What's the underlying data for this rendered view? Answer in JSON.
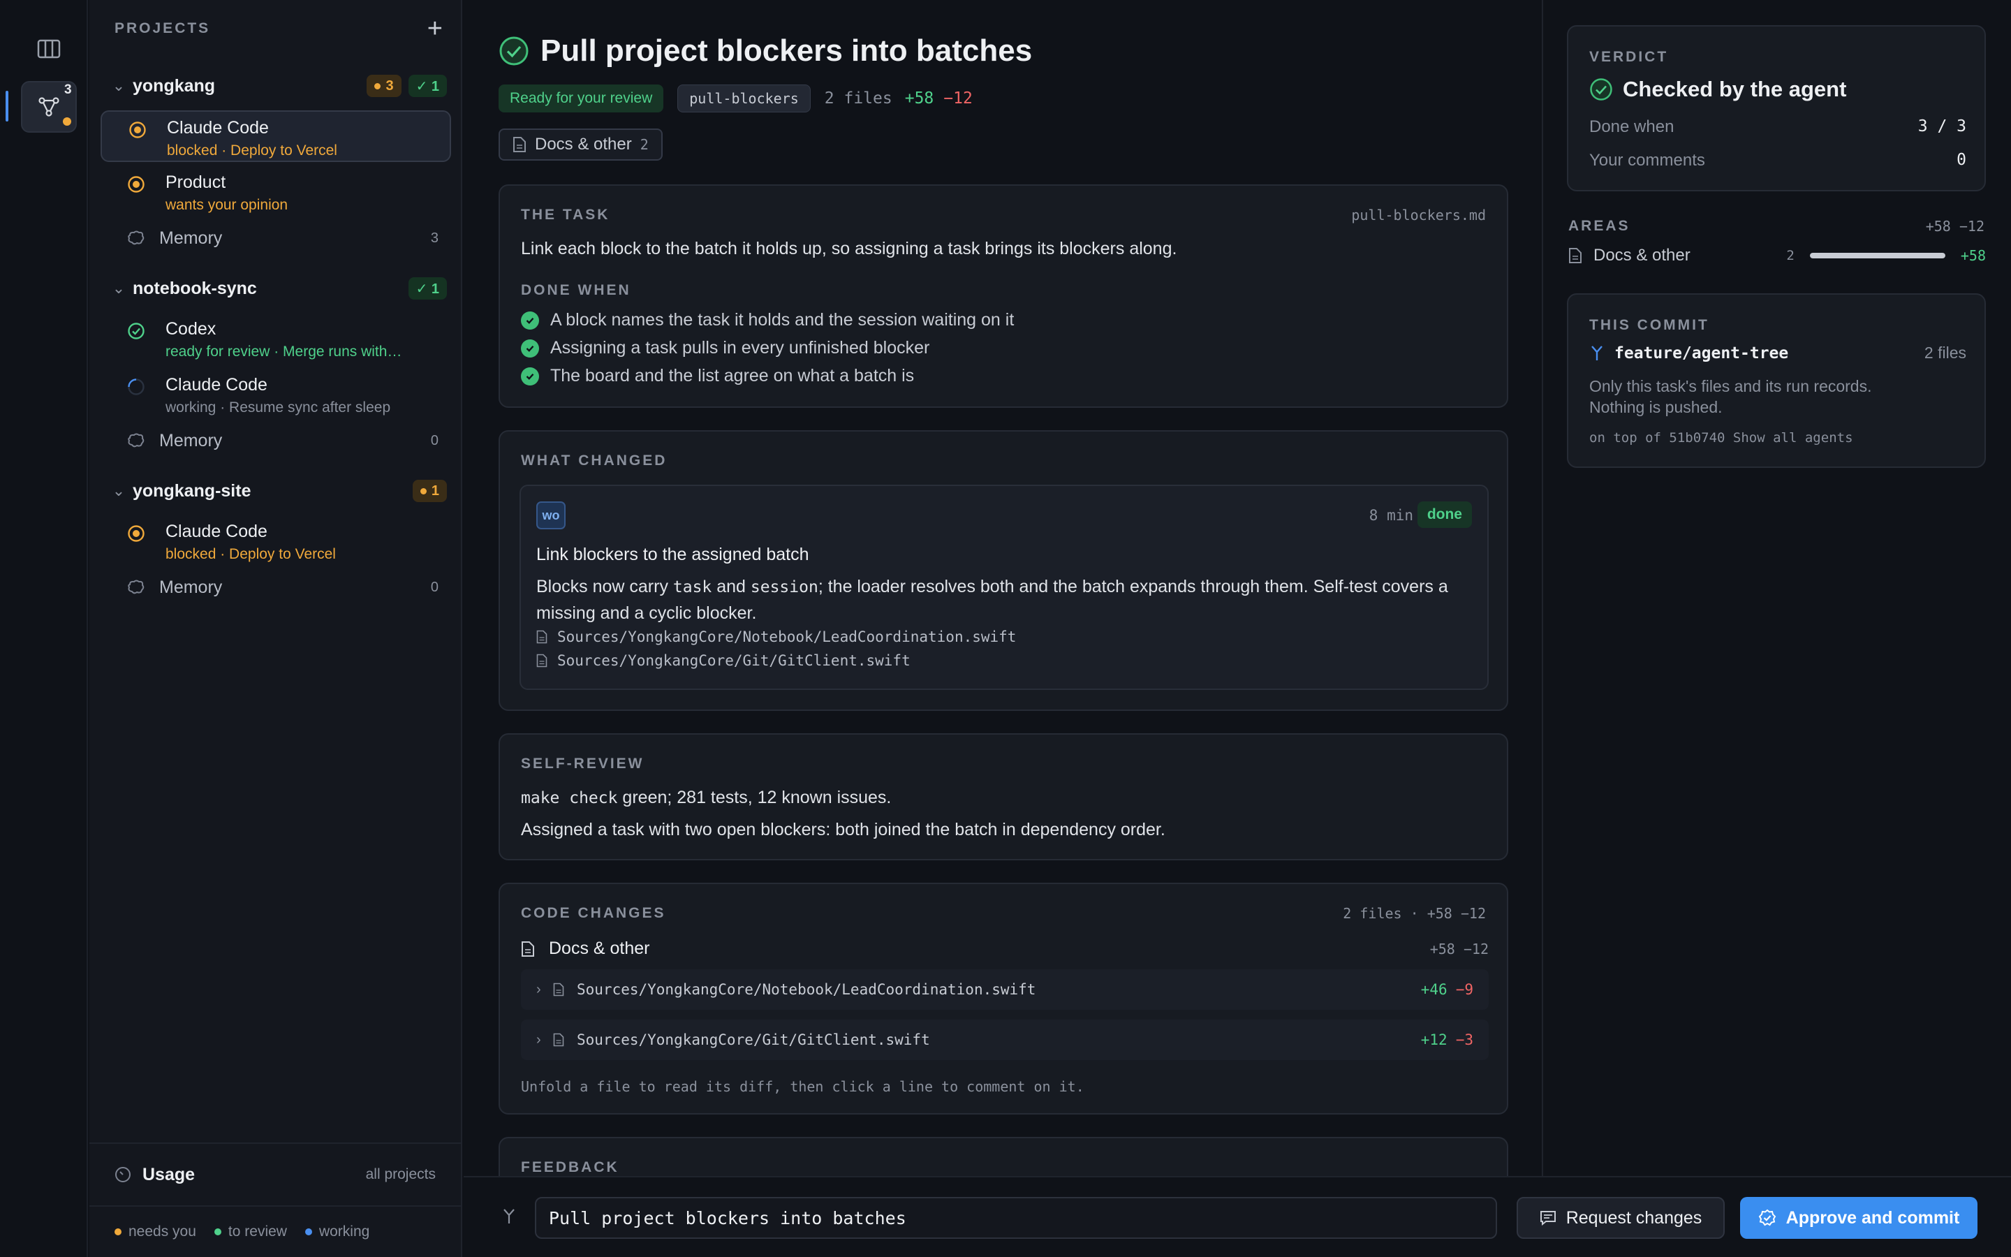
{
  "sidebar": {
    "header": "PROJECTS",
    "add": "+",
    "rail_badge": "3",
    "projects": [
      {
        "name": "yongkang",
        "needs_count": "3",
        "review_count": "✓ 1",
        "sessions": [
          {
            "title": "Claude Code",
            "subtitle": "blocked · Deploy to Vercel",
            "state": "blocked"
          },
          {
            "title": "Product",
            "subtitle": "wants your opinion",
            "state": "blocked"
          }
        ],
        "memory": {
          "label": "Memory",
          "count": "3"
        }
      },
      {
        "name": "notebook-sync",
        "review_count": "✓ 1",
        "sessions": [
          {
            "title": "Codex",
            "subtitle": "ready for review · Merge runs with…",
            "state": "review"
          },
          {
            "title": "Claude Code",
            "subtitle": "working · Resume sync after sleep",
            "state": "working"
          }
        ],
        "memory": {
          "label": "Memory",
          "count": "0"
        }
      },
      {
        "name": "yongkang-site",
        "needs_count": "1",
        "sessions": [
          {
            "title": "Claude Code",
            "subtitle": "blocked · Deploy to Vercel",
            "state": "blocked"
          }
        ],
        "memory": {
          "label": "Memory",
          "count": "0"
        }
      }
    ],
    "usage": {
      "label": "Usage",
      "scope": "all projects"
    },
    "legend": [
      {
        "label": "needs you",
        "color": "#f0a93b"
      },
      {
        "label": "to review",
        "color": "#4fd18b"
      },
      {
        "label": "working",
        "color": "#4a8ff0"
      }
    ]
  },
  "main": {
    "title": "Pull project blockers into batches",
    "status": "Ready for your review",
    "branch": "pull-blockers",
    "files": "2 files",
    "additions": "+58",
    "deletions": "−12",
    "area_chip": {
      "label": "Docs & other",
      "count": "2"
    },
    "task": {
      "header": "THE TASK",
      "file": "pull-blockers.md",
      "text": "Link each block to the batch it holds up, so assigning a task brings its blockers along.",
      "done_header": "DONE WHEN",
      "done": [
        "A block names the task it holds and the session waiting on it",
        "Assigning a task pulls in every unfinished blocker",
        "The board and the list agree on what a batch is"
      ]
    },
    "changed": {
      "header": "WHAT CHANGED",
      "badge": "wo",
      "time": "8 min",
      "status": "done",
      "title": "Link blockers to the assigned batch",
      "desc_1": "Blocks now carry ",
      "code_1": "task",
      "desc_2": " and ",
      "code_2": "session",
      "desc_3": "; the loader resolves both and the batch expands through them. Self-test covers a missing and a cyclic blocker.",
      "files": [
        "Sources/YongkangCore/Notebook/LeadCoordination.swift",
        "Sources/YongkangCore/Git/GitClient.swift"
      ]
    },
    "self_review": {
      "header": "SELF-REVIEW",
      "code": "make check",
      "line_1_rest": " green; 281 tests, 12 known issues.",
      "line_2": "Assigned a task with two open blockers: both joined the batch in dependency order."
    },
    "code_changes": {
      "header": "CODE CHANGES",
      "summary": "2 files · +58 −12",
      "group": "Docs & other",
      "group_stat": "+58 −12",
      "files": [
        {
          "path": "Sources/YongkangCore/Notebook/LeadCoordination.swift",
          "add": "+46",
          "del": "−9"
        },
        {
          "path": "Sources/YongkangCore/Git/GitClient.swift",
          "add": "+12",
          "del": "−3"
        }
      ],
      "hint": "Unfold a file to read its diff, then click a line to comment on it."
    },
    "feedback": {
      "header": "FEEDBACK"
    }
  },
  "right": {
    "verdict": {
      "header": "VERDICT",
      "title": "Checked by the agent",
      "rows": [
        {
          "label": "Done when",
          "value": "3 / 3"
        },
        {
          "label": "Your comments",
          "value": "0"
        }
      ]
    },
    "areas": {
      "header": "AREAS",
      "stat": "+58 −12",
      "items": [
        {
          "label": "Docs & other",
          "count": "2",
          "add": "+58",
          "fill": 1.0
        }
      ]
    },
    "commit": {
      "header": "THIS COMMIT",
      "branch": "feature/agent-tree",
      "files": "2 files",
      "note_1": "Only this task's files and its run records.",
      "note_2": "Nothing is pushed.",
      "base": "on top of 51b0740",
      "link": "Show all agents"
    }
  },
  "bottom": {
    "commit_message": "Pull project blockers into batches",
    "request_label": "Request changes",
    "approve_label": "Approve and commit"
  }
}
